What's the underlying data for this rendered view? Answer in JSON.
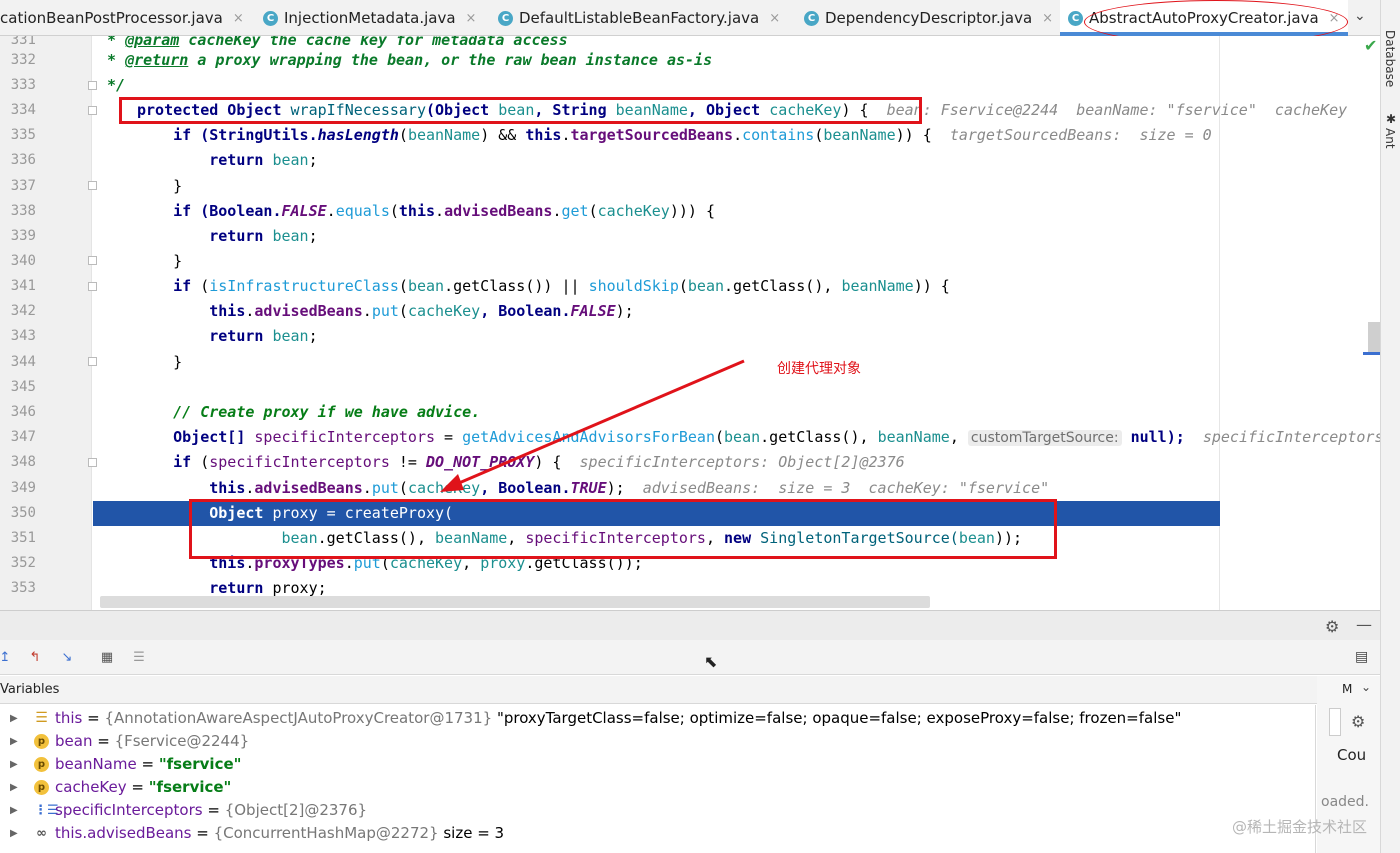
{
  "tabs": [
    {
      "label": "cationBeanPostProcessor.java",
      "has_icon": false
    },
    {
      "label": "InjectionMetadata.java",
      "has_icon": true
    },
    {
      "label": "DefaultListableBeanFactory.java",
      "has_icon": true
    },
    {
      "label": "DependencyDescriptor.java",
      "has_icon": true
    },
    {
      "label": "AbstractAutoProxyCreator.java",
      "has_icon": true,
      "active": true
    }
  ],
  "tab_icon_letter": "C",
  "tab_close": "×",
  "tab_menu": "⌄",
  "right_strip": {
    "database": "Database",
    "ant": "Ant"
  },
  "annotation_text": "创建代理对象",
  "line_numbers": [
    "331",
    "332",
    "333",
    "334",
    "335",
    "336",
    "337",
    "338",
    "339",
    "340",
    "341",
    "342",
    "343",
    "344",
    "345",
    "346",
    "347",
    "348",
    "349",
    "350",
    "351",
    "352",
    "353"
  ],
  "code": {
    "l331a": " * ",
    "l331b": "@param",
    "l331c": " cacheKey the cache key for metadata access",
    "l332a": " * ",
    "l332b": "@return",
    "l332c": " a proxy wrapping the bean, or the raw bean instance as-is",
    "l333": " */",
    "l334a": "protected",
    "l334b": " Object ",
    "l334c": "wrapIfNecessary",
    "l334d": "(Object ",
    "l334e": "bean",
    "l334f": ", String ",
    "l334g": "beanName",
    "l334h": ", Object ",
    "l334i": "cacheKey",
    "l334j": ") {  ",
    "l334k": "bean: Fservice@2244  beanName: \"fservice\"  cacheKey",
    "l335a": "    if",
    "l335b": " (StringUtils.",
    "l335c": "hasLength",
    "l335d": "(",
    "l335e": "beanName",
    "l335f": ") && ",
    "l335g": "this",
    "l335h": ".",
    "l335i": "targetSourcedBeans",
    "l335j": ".",
    "l335k": "contains",
    "l335l": "(",
    "l335m": "beanName",
    "l335n": ")) {  ",
    "l335o": "targetSourcedBeans:  size = 0",
    "l336a": "        return",
    "l336b": " bean",
    "l336c": ";",
    "l337": "    }",
    "l338a": "    if",
    "l338b": " (Boolean.",
    "l338c": "FALSE",
    "l338d": ".",
    "l338e": "equals",
    "l338f": "(",
    "l338g": "this",
    "l338h": ".",
    "l338i": "advisedBeans",
    "l338j": ".",
    "l338k": "get",
    "l338l": "(",
    "l338m": "cacheKey",
    "l338n": "))) {",
    "l339a": "        return",
    "l339b": " bean",
    "l339c": ";",
    "l340": "    }",
    "l341a": "    if",
    "l341b": " (",
    "l341c": "isInfrastructureClass",
    "l341d": "(",
    "l341e": "bean",
    "l341f": ".getClass()) || ",
    "l341g": "shouldSkip",
    "l341h": "(",
    "l341i": "bean",
    "l341j": ".getClass(), ",
    "l341k": "beanName",
    "l341l": ")) {",
    "l342a": "        this",
    "l342b": ".",
    "l342c": "advisedBeans",
    "l342d": ".",
    "l342e": "put",
    "l342f": "(",
    "l342g": "cacheKey",
    "l342h": ", Boolean.",
    "l342i": "FALSE",
    "l342j": ");",
    "l343a": "        return",
    "l343b": " bean",
    "l343c": ";",
    "l344": "    }",
    "l345": "",
    "l346": "    // Create proxy if we have advice.",
    "l347a": "    Object[] ",
    "l347b": "specificInterceptors",
    "l347c": " = ",
    "l347d": "getAdvicesAndAdvisorsForBean",
    "l347e": "(",
    "l347f": "bean",
    "l347g": ".getClass(), ",
    "l347h": "beanName",
    "l347i": ", ",
    "l347j": "customTargetSource:",
    "l347k": " null);  ",
    "l347l": "specificInterceptors",
    "l348a": "    if",
    "l348b": " (",
    "l348c": "specificInterceptors",
    "l348d": " != ",
    "l348e": "DO_NOT_PROXY",
    "l348f": ") {  ",
    "l348g": "specificInterceptors: Object[2]@2376",
    "l349a": "        this",
    "l349b": ".",
    "l349c": "advisedBeans",
    "l349d": ".",
    "l349e": "put",
    "l349f": "(",
    "l349g": "cacheKey",
    "l349h": ", Boolean.",
    "l349i": "TRUE",
    "l349j": ");  ",
    "l349k": "advisedBeans:  size = 3  cacheKey: \"fservice\"",
    "l350a": "        Object ",
    "l350b": "proxy",
    "l350c": " = createProxy(",
    "l351a": "                ",
    "l351b": "bean",
    "l351c": ".getClass(), ",
    "l351d": "beanName",
    "l351e": ", ",
    "l351f": "specificInterceptors",
    "l351g": ", ",
    "l351h": "new",
    "l351i": " SingletonTargetSource(",
    "l351j": "bean",
    "l351k": "));",
    "l352a": "        this",
    "l352b": ".",
    "l352c": "proxyTypes",
    "l352d": ".",
    "l352e": "put",
    "l352f": "(",
    "l352g": "cacheKey",
    "l352h": ", ",
    "l352i": "proxy",
    "l352j": ".getClass());",
    "l353a": "        return",
    "l353b": " proxy",
    "l353c": ";"
  },
  "debug": {
    "panel_title": "Variables",
    "watch_label_1": "Cou",
    "watch_label_2": "oaded.",
    "watch_label_3": "M"
  },
  "variables": [
    {
      "icon": "list",
      "name": "this",
      "eq": " = ",
      "ref": "{AnnotationAwareAspectJAutoProxyCreator@1731}",
      "extra": " \"proxyTargetClass=false; optimize=false; opaque=false; exposeProxy=false; frozen=false\""
    },
    {
      "icon": "p",
      "name": "bean",
      "eq": " = ",
      "ref": "{Fservice@2244}",
      "extra": ""
    },
    {
      "icon": "p",
      "name": "beanName",
      "eq": " = ",
      "ref": "",
      "str": "\"fservice\""
    },
    {
      "icon": "p",
      "name": "cacheKey",
      "eq": " = ",
      "ref": "",
      "str": "\"fservice\""
    },
    {
      "icon": "arr",
      "name": "specificInterceptors",
      "eq": " = ",
      "ref": "{Object[2]@2376}",
      "extra": ""
    },
    {
      "icon": "glass",
      "name": "this.advisedBeans",
      "eq": " = ",
      "ref": "{ConcurrentHashMap@2272}",
      "extra": "  size = 3"
    }
  ],
  "watermark": "@稀土掘金技术社区"
}
